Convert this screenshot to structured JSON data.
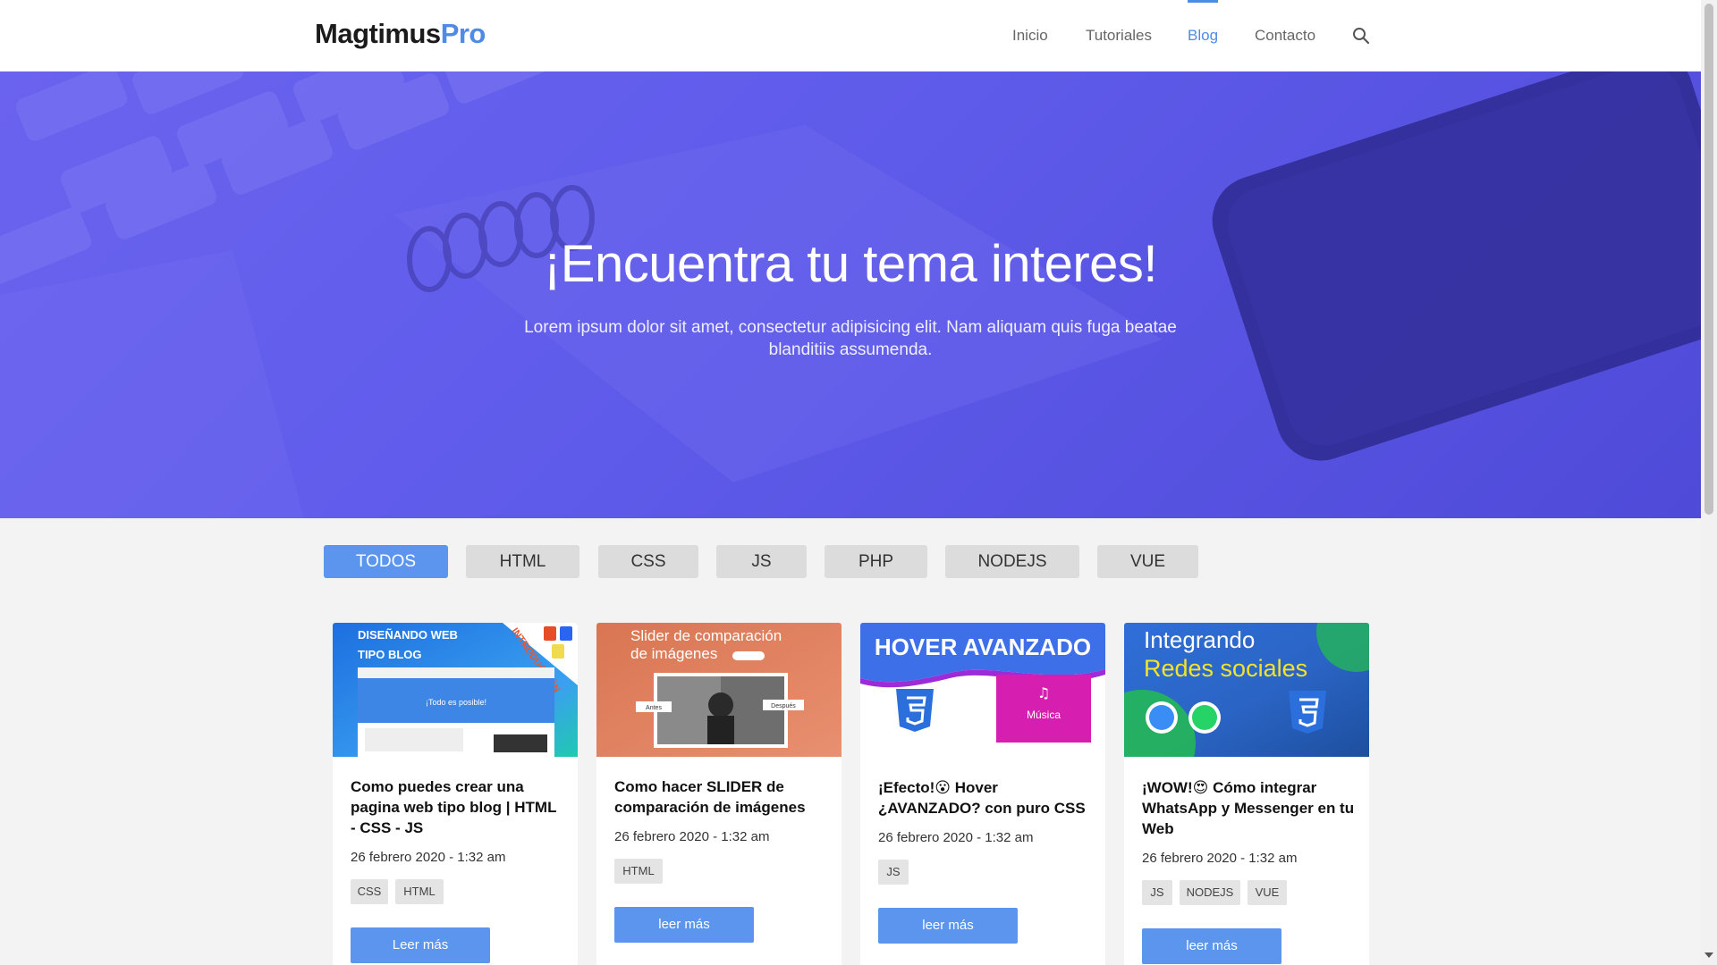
{
  "header": {
    "logo_main": "Magtimus",
    "logo_accent": "Pro",
    "nav": [
      "Inicio",
      "Tutoriales",
      "Blog",
      "Contacto"
    ],
    "active_nav": "Blog",
    "search_icon": "search-icon"
  },
  "hero": {
    "title": "¡Encuentra tu tema interes!",
    "subtitle": "Lorem ipsum dolor sit amet, consectetur adipisicing elit. Nam aliquam quis fuga beatae blanditiis assumenda."
  },
  "filters": [
    "TODOS",
    "HTML",
    "CSS",
    "JS",
    "PHP",
    "NODEJS",
    "VUE"
  ],
  "active_filter": "TODOS",
  "posts": [
    {
      "thumb_line1": "DISEÑANDO WEB",
      "thumb_line2": "TIPO BLOG",
      "thumb_ribbon": "INTRODUCCIÓN",
      "thumb_tagline": "¡Todo es posible!",
      "title": "Como puedes crear una pagina web tipo blog | HTML - CSS - JS",
      "date": "26 febrero 2020 - 1:32 am",
      "tags": [
        "CSS",
        "HTML"
      ],
      "button": "Leer más"
    },
    {
      "thumb_line1": "Slider de comparación",
      "thumb_line2": "de imágenes",
      "thumb_left": "Antes",
      "thumb_right": "Después",
      "title": "Como hacer SLIDER de comparación de imágenes",
      "date": "26 febrero 2020 - 1:32 am",
      "tags": [
        "HTML"
      ],
      "button": "leer más"
    },
    {
      "thumb_line1": "HOVER AVANZADO",
      "thumb_label": "Música",
      "title": "¡Efecto!😮 Hover ¿AVANZADO? con puro CSS",
      "date": "26 febrero 2020 - 1:32 am",
      "tags": [
        "JS"
      ],
      "button": "leer más"
    },
    {
      "thumb_line1": "Integrando",
      "thumb_line2": "Redes sociales",
      "title": "¡WOW!😍 Cómo integrar WhatsApp y Messenger en tu Web",
      "date": "26 febrero 2020 - 1:32 am",
      "tags": [
        "JS",
        "NODEJS",
        "VUE"
      ],
      "button": "leer más"
    }
  ],
  "colors": {
    "accent": "#4f8be6",
    "button": "#5b95ee",
    "hero": "#5f5bea",
    "tag_bg": "#e4e4e4",
    "page_bg": "#f3f3f4"
  }
}
